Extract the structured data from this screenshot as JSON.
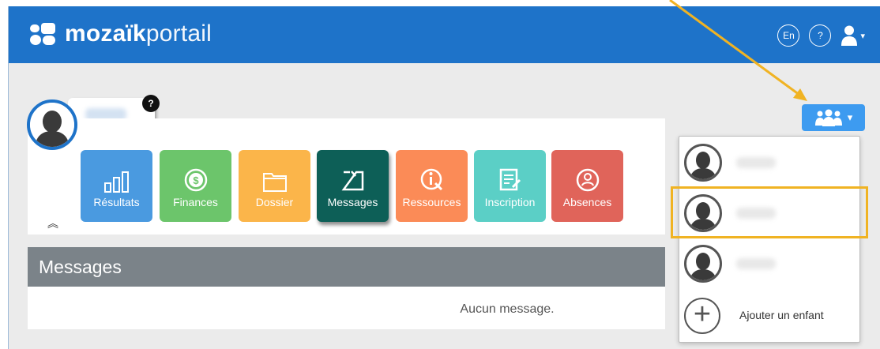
{
  "header": {
    "brand_bold": "mozaïk",
    "brand_light": "portail",
    "lang_button": "En",
    "help_button": "?",
    "user_icon": "user-icon",
    "caret": "▾"
  },
  "profile": {
    "help_badge": "?",
    "avatar_icon": "person-silhouette-icon"
  },
  "tiles": [
    {
      "label": "Résultats",
      "color": "#4a9ae0",
      "icon": "bar-chart-icon"
    },
    {
      "label": "Finances",
      "color": "#6cc56b",
      "icon": "dollar-coin-icon"
    },
    {
      "label": "Dossier",
      "color": "#fbb54a",
      "icon": "folder-icon"
    },
    {
      "label": "Messages",
      "color": "#0d5f57",
      "icon": "message-icon"
    },
    {
      "label": "Ressources",
      "color": "#fb8b57",
      "icon": "resources-icon"
    },
    {
      "label": "Inscription",
      "color": "#5bcfc6",
      "icon": "form-icon"
    },
    {
      "label": "Absences",
      "color": "#e0645a",
      "icon": "absence-icon"
    }
  ],
  "collapse_glyph": "︽",
  "messages": {
    "title": "Messages",
    "empty": "Aucun message."
  },
  "children_button": {
    "icon": "group-icon",
    "caret": "▾"
  },
  "dropdown": {
    "add_child": "Ajouter un enfant",
    "add_icon": "plus-circle-icon",
    "add_symbol": "+"
  },
  "colors": {
    "header_blue": "#1e73c9",
    "accent_blue": "#3d9bf0",
    "highlight": "#f0b323",
    "section_gray": "#7b8389"
  }
}
